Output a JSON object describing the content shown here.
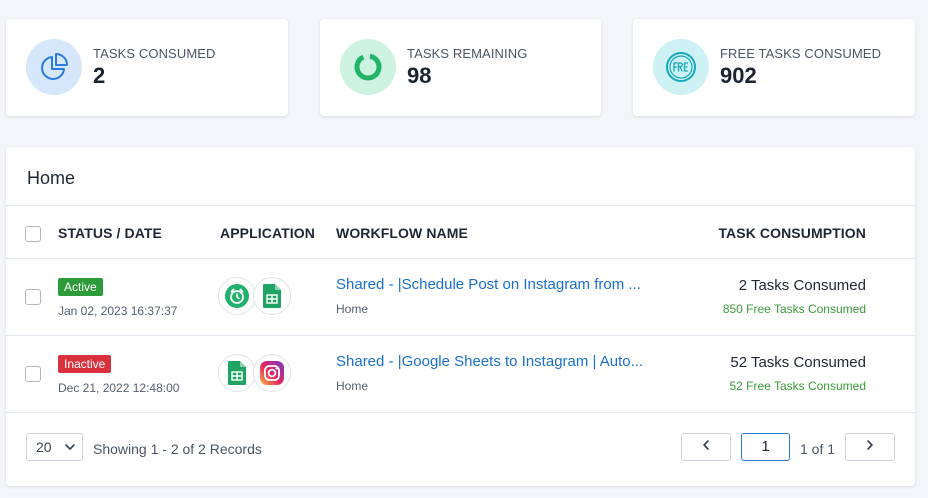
{
  "stats": [
    {
      "label": "TASKS CONSUMED",
      "value": "2",
      "icon": "pie-chart-icon",
      "icon_bg": "#d6e6fb",
      "icon_color": "#2d7be0"
    },
    {
      "label": "TASKS REMAINING",
      "value": "98",
      "icon": "donut-chart-icon",
      "icon_bg": "#cdf3e0",
      "icon_color": "#22b46a"
    },
    {
      "label": "FREE TASKS CONSUMED",
      "value": "902",
      "icon": "free-badge-icon",
      "icon_bg": "#cdf1f4",
      "icon_color": "#16a9b8"
    }
  ],
  "panel": {
    "title": "Home",
    "columns": {
      "status": "STATUS / DATE",
      "application": "APPLICATION",
      "workflow": "WORKFLOW NAME",
      "consumption": "TASK CONSUMPTION"
    },
    "rows": [
      {
        "status": "Active",
        "status_color": "#2d9b3a",
        "date": "Jan 02, 2023 16:37:37",
        "apps": [
          "alarm-clock-icon",
          "google-sheets-icon"
        ],
        "workflow": "Shared - |Schedule Post on Instagram from ...",
        "folder": "Home",
        "tasks": "2 Tasks Consumed",
        "free_tasks": "850 Free Tasks Consumed"
      },
      {
        "status": "Inactive",
        "status_color": "#d9303d",
        "date": "Dec 21, 2022 12:48:00",
        "apps": [
          "google-sheets-icon",
          "instagram-icon"
        ],
        "workflow": "Shared - |Google Sheets to Instagram | Auto...",
        "folder": "Home",
        "tasks": "52 Tasks Consumed",
        "free_tasks": "52 Free Tasks Consumed"
      }
    ]
  },
  "footer": {
    "page_size": "20",
    "showing": "Showing 1 - 2 of 2 Records",
    "current_page": "1",
    "page_of": "1 of 1"
  }
}
